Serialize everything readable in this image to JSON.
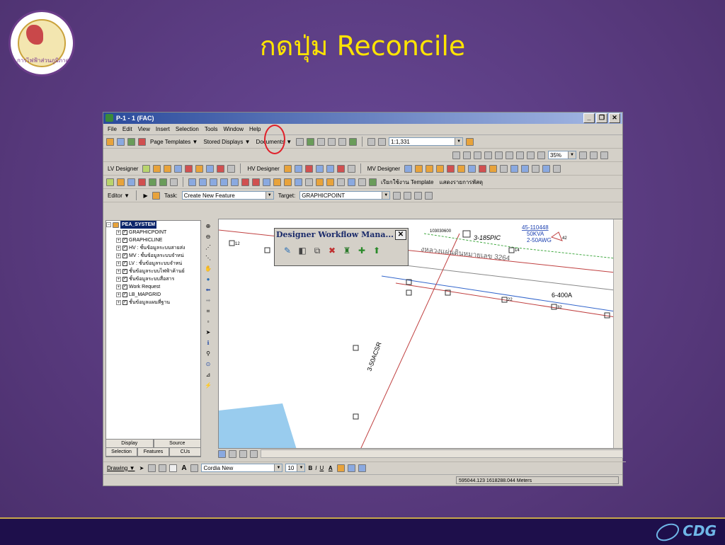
{
  "slide": {
    "title": "กดปุ่ม Reconcile",
    "logo_text": "การไฟฟ้าส่วนภูมิภาค",
    "brand": "CDG"
  },
  "window": {
    "title": "P-1 - 1 (FAC)",
    "min": "_",
    "restore": "❐",
    "close": "✕"
  },
  "menu": [
    "File",
    "Edit",
    "View",
    "Insert",
    "Selection",
    "Tools",
    "Window",
    "Help"
  ],
  "toolbar1": {
    "page_templates": "Page Templates ▼",
    "stored_displays": "Stored Displays ▼",
    "documents": "Documents ▼",
    "scale": "1:1,331"
  },
  "toolbar2": {
    "zoom": "35%"
  },
  "designers": {
    "lv": "LV Designer",
    "hv": "HV Designer",
    "mv": "MV Designer"
  },
  "toolbar4": {
    "template_btn": "เรียกใช้งาน Template",
    "show_btn": "แสดงรายการพัสดุ"
  },
  "editor": {
    "editor_label": "Editor ▼",
    "task_label": "Task:",
    "task_value": "Create New Feature",
    "target_label": "Target:",
    "target_value": "GRAPHICPOINT"
  },
  "toc": {
    "root": "PEA_SYSTEM",
    "layers": [
      "GRAPHICPOINT",
      "GRAPHICLINE",
      "HV : ชั้นข้อมูลระบบสายส่ง",
      "MV : ชั้นข้อมูลระบบจำหน่",
      "LV : ชั้นข้อมูลระบบจำหน่",
      "ชั้นข้อมูลระบบไฟฟ้าค้านย์",
      "ชั้นข้อมูลระบบสื่อสาร",
      "Work Request",
      "LB_MAPGRID",
      "ชั้นข้อมูลแผนที่ฐาน"
    ],
    "tabs_top": [
      "Display",
      "Source"
    ],
    "tabs_bottom": [
      "Selection",
      "Features",
      "CUs"
    ]
  },
  "dialog": {
    "title": "Designer Workflow Mana...",
    "close": "✕"
  },
  "map": {
    "labels": {
      "l1": "103030600",
      "l2": "3-185PIC",
      "l3": "45-110448",
      "l4": "50KVA",
      "l5": "2-50AWG",
      "l6": "งหลวงแผ่นดินหมายเลข 3264",
      "l7": "6-400A",
      "l8": "3-50ACSR",
      "t12": "12",
      "t14": "14",
      "t22": "22",
      "t32": "32",
      "t42": "42"
    }
  },
  "drawing": {
    "label": "Drawing ▼",
    "font": "Cordia New",
    "size": "10",
    "bold": "B",
    "italic": "I",
    "underline": "U"
  },
  "status": {
    "coords": "595044.123  1618288.044 Meters"
  }
}
